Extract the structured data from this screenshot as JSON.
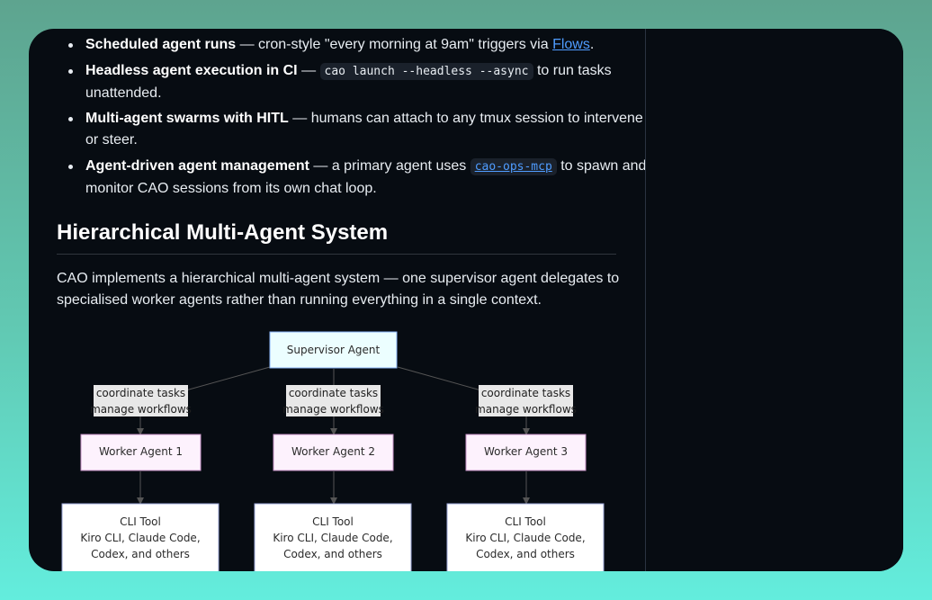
{
  "features": [
    {
      "title": "Scheduled agent runs",
      "before": " — cron-style \"every morning at 9am\" triggers via ",
      "link": "Flows",
      "after": "."
    },
    {
      "title": "Headless agent execution in CI",
      "before": " — ",
      "code": "cao launch --headless --async",
      "after": " to run tasks unattended."
    },
    {
      "title": "Multi-agent swarms with HITL",
      "text": " — humans can attach to any tmux session to intervene or steer."
    },
    {
      "title": "Agent-driven agent management",
      "before": " — a primary agent uses ",
      "code": "cao-ops-mcp",
      "after": " to spawn and monitor CAO sessions from its own chat loop."
    }
  ],
  "section": {
    "title": "Hierarchical Multi-Agent System",
    "intro": "CAO implements a hierarchical multi-agent system — one supervisor agent delegates to specialised worker agents rather than running everything in a single context."
  },
  "diagram": {
    "supervisor": "Supervisor Agent",
    "edge_label": [
      "coordinate tasks",
      "manage workflows"
    ],
    "workers": [
      "Worker Agent 1",
      "Worker Agent 2",
      "Worker Agent 3"
    ],
    "tool_lines": [
      "CLI Tool",
      "Kiro CLI, Claude Code,",
      "Codex, and others"
    ],
    "colors": {
      "supervisor_fill": "#ecfeff",
      "supervisor_stroke": "#8ab4f8",
      "worker_fill": "#fdf2fd",
      "worker_stroke": "#c792c7",
      "tool_fill": "#ffffff",
      "tool_stroke": "#9aa4d6",
      "edge_label_fill": "#e8e8e8",
      "edge": "#555555"
    }
  }
}
